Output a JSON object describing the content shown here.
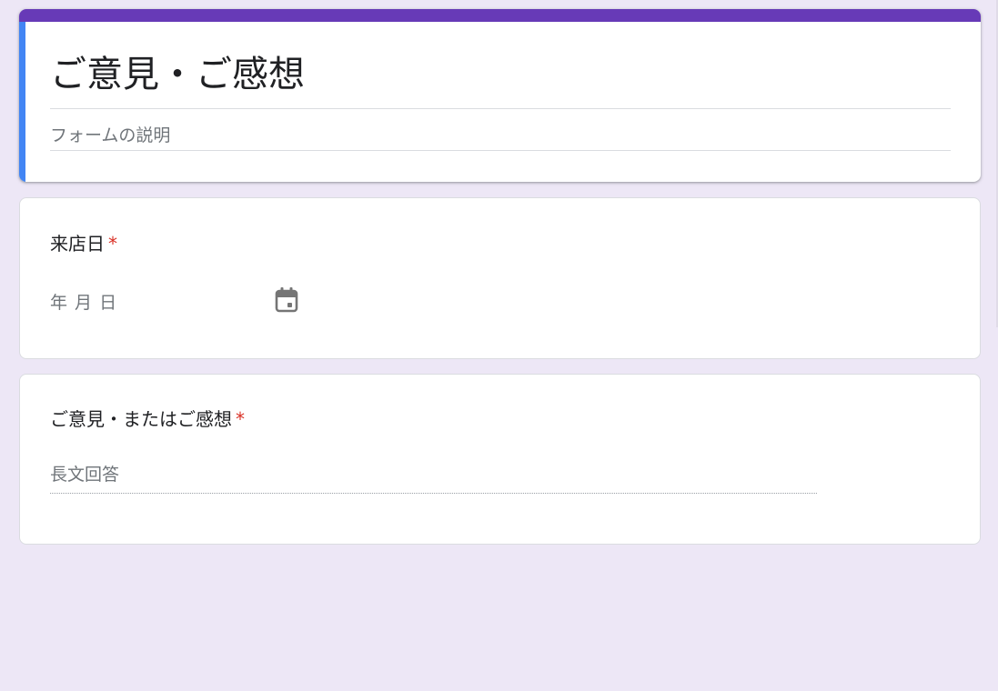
{
  "form": {
    "title": "ご意見・ご感想",
    "description_placeholder": "フォームの説明"
  },
  "questions": [
    {
      "title": "来店日",
      "required_mark": "*",
      "type": "date",
      "placeholder": "年 月 日",
      "icon": "calendar-icon"
    },
    {
      "title": "ご意見・またはご感想",
      "required_mark": "*",
      "type": "paragraph",
      "placeholder": "長文回答"
    }
  ],
  "colors": {
    "theme": "#673ab7",
    "active_indicator": "#4285f4",
    "background": "#ede7f6",
    "required": "#d93025"
  }
}
